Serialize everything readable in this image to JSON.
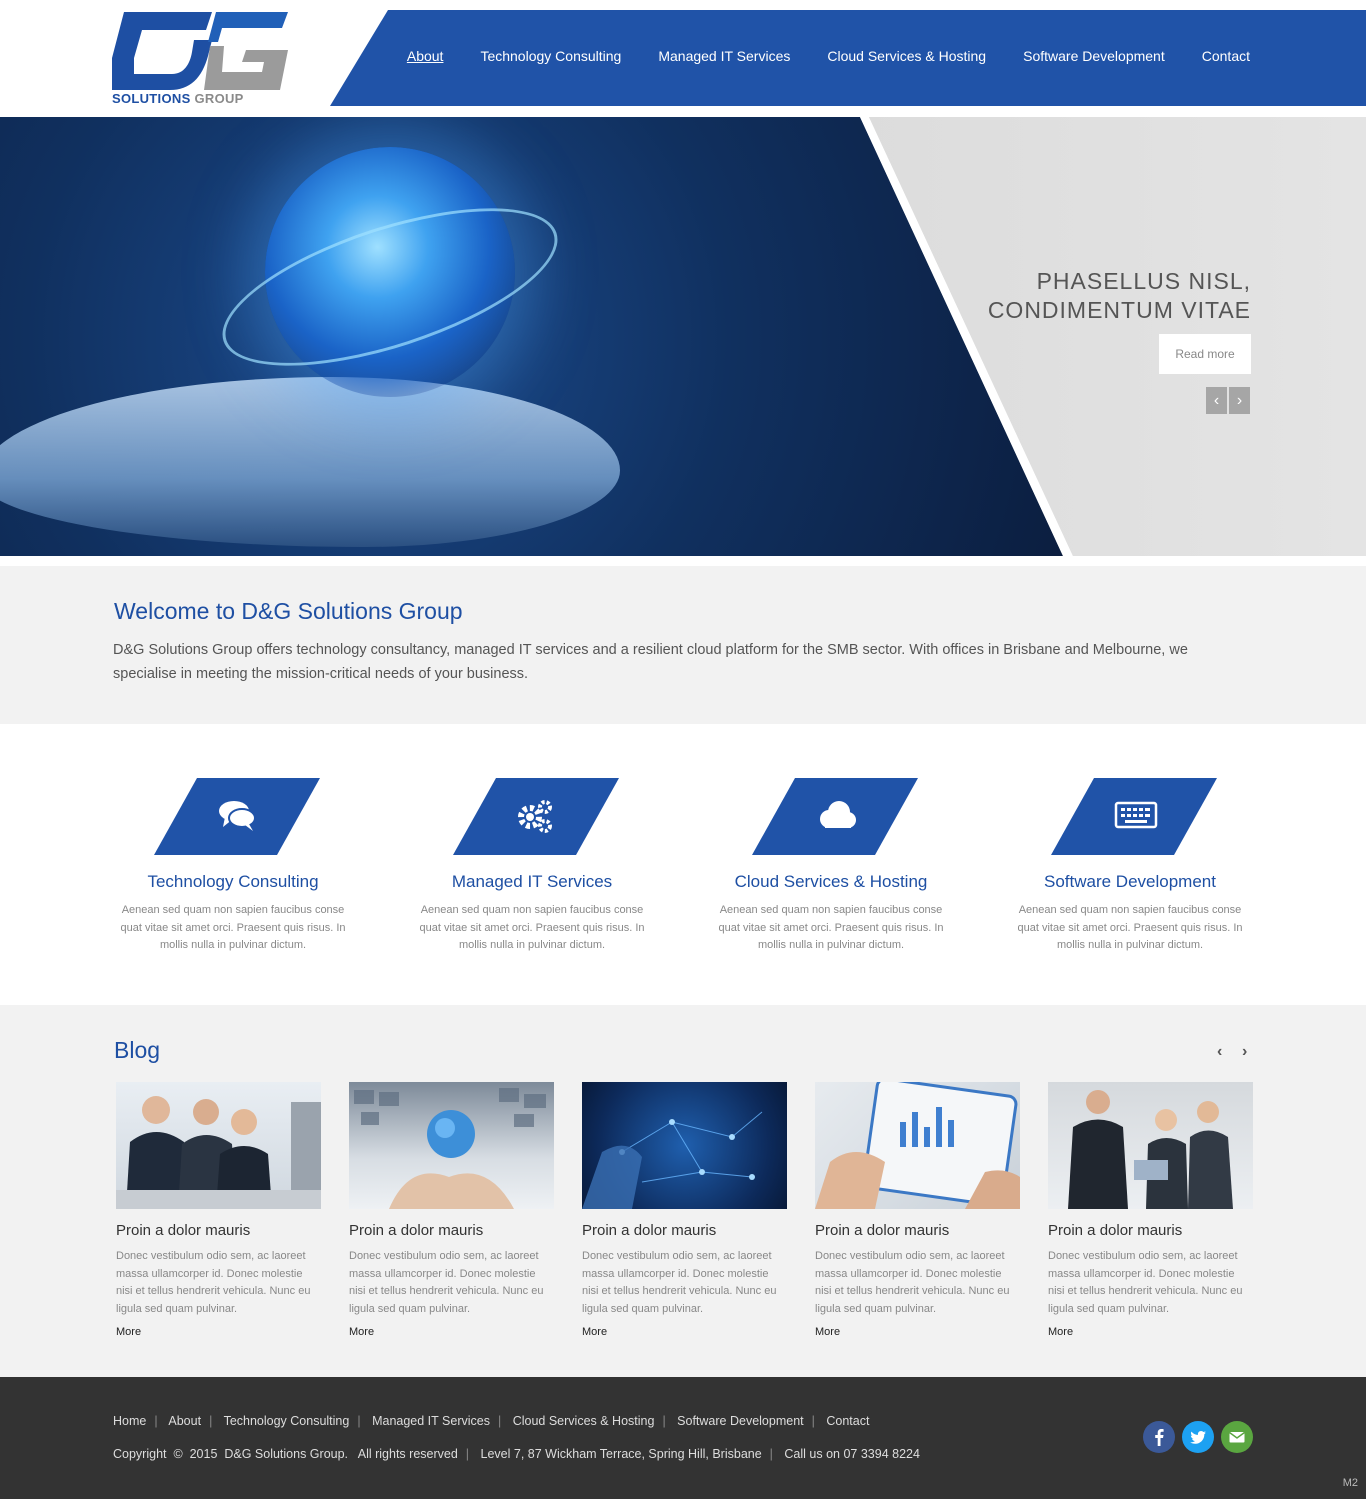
{
  "brand": {
    "logo_word_1": "SOLUTIONS",
    "logo_word_2": "GROUP",
    "colors": {
      "primary": "#2053a8",
      "heading": "#1e4fa3",
      "footer_bg": "#333333",
      "light_bg": "#f2f2f2"
    }
  },
  "nav": {
    "items": [
      {
        "label": "About",
        "active": true
      },
      {
        "label": "Technology Consulting"
      },
      {
        "label": "Managed IT Services"
      },
      {
        "label": "Cloud Services & Hosting"
      },
      {
        "label": "Software Development"
      },
      {
        "label": "Contact"
      }
    ]
  },
  "hero": {
    "title_line_1": "PHASELLUS NISL,",
    "title_line_2": "CONDIMENTUM VITAE",
    "button_label": "Read more",
    "prev_icon": "‹",
    "next_icon": "›"
  },
  "welcome": {
    "title": "Welcome to D&G Solutions Group",
    "text": "D&G Solutions Group offers technology consultancy, managed IT services and a resilient cloud platform for the SMB sector. With offices in Brisbane and Melbourne, we specialise in meeting the mission-critical needs of your business."
  },
  "services": [
    {
      "title": "Technology Consulting",
      "icon": "chat-icon",
      "text": "Aenean sed quam non sapien faucibus conse quat vitae sit amet orci. Praesent quis risus. In mollis nulla in pulvinar dictum."
    },
    {
      "title": "Managed IT Services",
      "icon": "gears-icon",
      "text": "Aenean sed quam non sapien faucibus conse quat vitae sit amet orci. Praesent quis risus. In mollis nulla in pulvinar dictum."
    },
    {
      "title": "Cloud Services & Hosting",
      "icon": "cloud-icon",
      "text": "Aenean sed quam non sapien faucibus conse quat vitae sit amet orci. Praesent quis risus. In mollis nulla in pulvinar dictum."
    },
    {
      "title": "Software Development",
      "icon": "keyboard-icon",
      "text": "Aenean sed quam non sapien faucibus conse quat vitae sit amet orci. Praesent quis risus. In mollis nulla in pulvinar dictum."
    }
  ],
  "blog": {
    "title": "Blog",
    "prev_icon": "‹",
    "next_icon": "›",
    "posts": [
      {
        "title": "Proin a dolor mauris",
        "text": "Donec vestibulum odio sem, ac laoreet massa ullamcorper id. Donec molestie nisi et tellus hendrerit vehicula. Nunc eu ligula sed quam pulvinar.",
        "more": "More"
      },
      {
        "title": "Proin a dolor mauris",
        "text": "Donec vestibulum odio sem, ac laoreet massa ullamcorper id. Donec molestie nisi et tellus hendrerit vehicula. Nunc eu ligula sed quam pulvinar.",
        "more": "More"
      },
      {
        "title": "Proin a dolor mauris",
        "text": "Donec vestibulum odio sem, ac laoreet massa ullamcorper id. Donec molestie nisi et tellus hendrerit vehicula. Nunc eu ligula sed quam pulvinar.",
        "more": "More"
      },
      {
        "title": "Proin a dolor mauris",
        "text": "Donec vestibulum odio sem, ac laoreet massa ullamcorper id. Donec molestie nisi et tellus hendrerit vehicula. Nunc eu ligula sed quam pulvinar.",
        "more": "More"
      },
      {
        "title": "Proin a dolor mauris",
        "text": "Donec vestibulum odio sem, ac laoreet massa ullamcorper id. Donec molestie nisi et tellus hendrerit vehicula. Nunc eu ligula sed quam pulvinar.",
        "more": "More"
      }
    ]
  },
  "footer": {
    "links": [
      "Home",
      "About",
      "Technology Consulting",
      "Managed IT Services",
      "Cloud Services & Hosting",
      "Software Development",
      "Contact"
    ],
    "separator": "|",
    "copyright": "Copyright  ©  2015  D&G Solutions Group.   All rights reserved",
    "address": "Level 7, 87 Wickham Terrace, Spring Hill, Brisbane",
    "phone": "Call us on 07 3394 8224",
    "social": [
      {
        "name": "facebook-icon",
        "glyph": "f",
        "color": "#3b5998"
      },
      {
        "name": "twitter-icon",
        "glyph": "t",
        "color": "#1da1f2"
      },
      {
        "name": "email-icon",
        "glyph": "✉",
        "color": "#5aa640"
      }
    ],
    "badge": "M2"
  }
}
